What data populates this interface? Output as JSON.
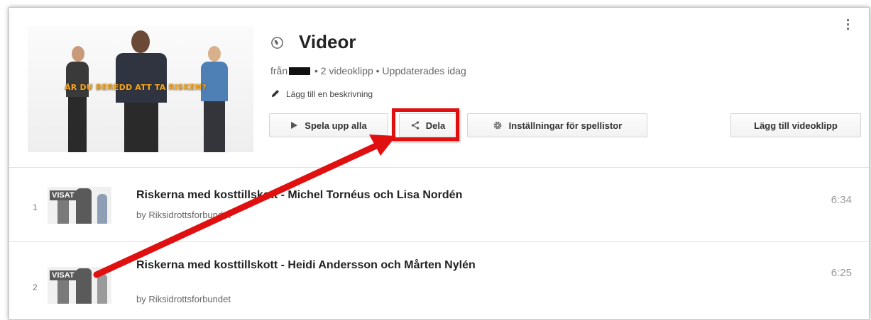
{
  "playlist": {
    "title": "Videor",
    "meta_from": "från",
    "meta_rest": "• 2 videoklipp • Uppdaterades idag",
    "add_description": "Lägg till en beskrivning",
    "hero_text": "ÄR DU BEREDD ATT TA RISKEN?"
  },
  "actions": {
    "play_all": "Spela upp alla",
    "share": "Dela",
    "settings": "Inställningar för spellistor",
    "add_video": "Lägg till videoklipp"
  },
  "videos": [
    {
      "index": "1",
      "badge": "VISAT",
      "title": "Riskerna med kosttillskott - Michel Tornéus och Lisa Nordén",
      "by": "by Riksidrottsforbundet",
      "duration": "6:34"
    },
    {
      "index": "2",
      "badge": "VISAT",
      "title": "Riskerna med kosttillskott - Heidi Andersson och Mårten Nylén",
      "by": "by Riksidrottsforbundet",
      "duration": "6:25"
    }
  ],
  "icons": {
    "globe": "globe-icon",
    "pencil": "pencil-icon",
    "play": "play-icon",
    "share": "share-icon",
    "gear": "gear-icon",
    "more": "more-vert-icon",
    "arrow": "annotation-arrow"
  },
  "colors": {
    "highlight": "#e01010",
    "hero_text": "#f5a623"
  }
}
